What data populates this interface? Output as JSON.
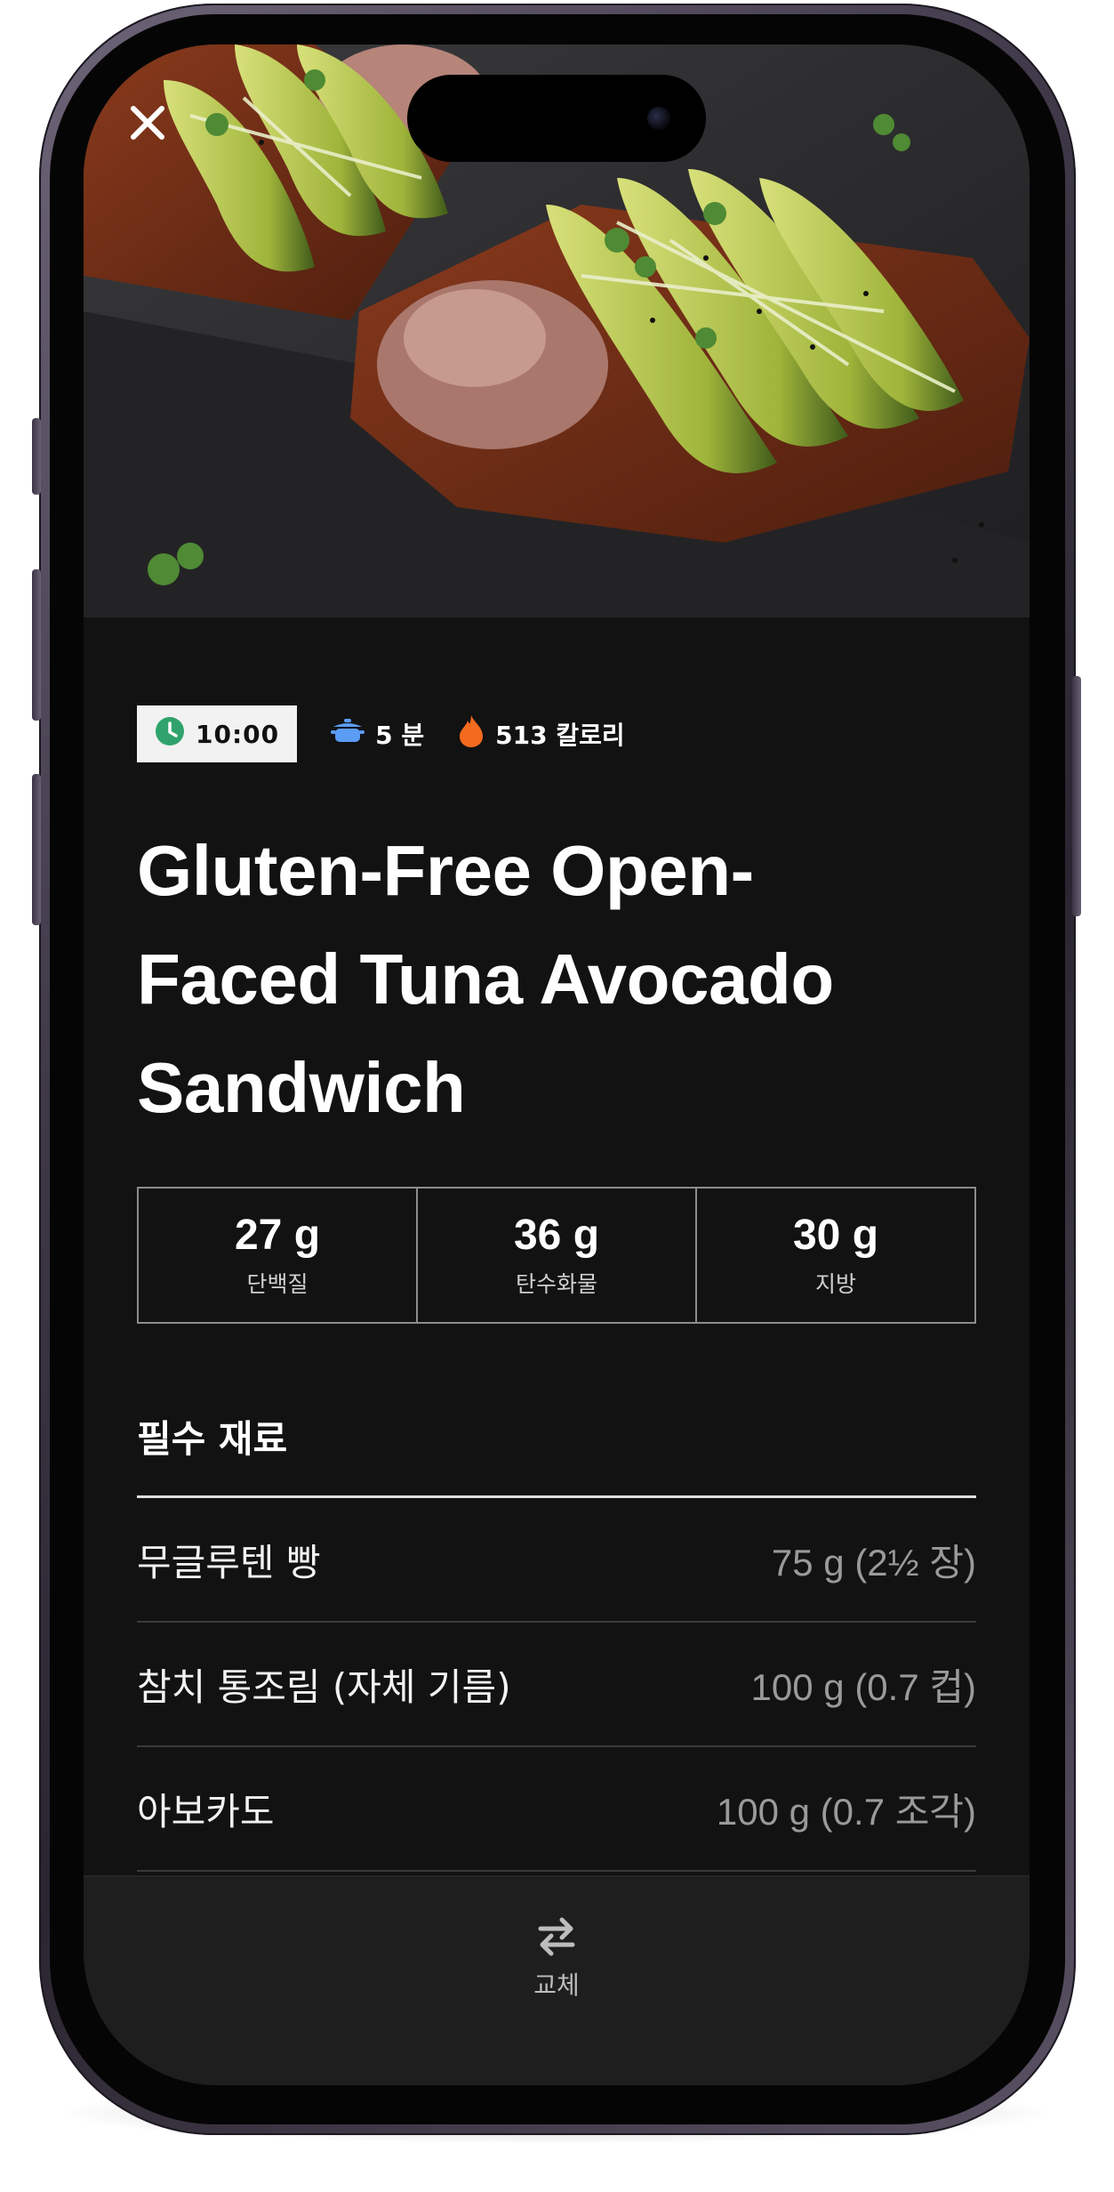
{
  "app": {
    "close_icon": "close-icon"
  },
  "meta": {
    "time": "10:00",
    "servings": "5 분",
    "calories": "513 칼로리",
    "colors": {
      "clock": "#2fa36b",
      "pot": "#5b9cf5",
      "flame": "#f46a1e"
    }
  },
  "recipe": {
    "title": "Gluten-Free Open-Faced Tuna Avocado Sandwich"
  },
  "macros": [
    {
      "value": "27 g",
      "label": "단백질"
    },
    {
      "value": "36 g",
      "label": "탄수화물"
    },
    {
      "value": "30 g",
      "label": "지방"
    }
  ],
  "ingredients": {
    "heading": "필수 재료",
    "items": [
      {
        "name": "무글루텐 빵",
        "amount": "75 g (2½ 장)"
      },
      {
        "name": "참치 통조림 (자체 기름)",
        "amount": "100 g (0.7 컵)"
      },
      {
        "name": "아보카도",
        "amount": "100 g (0.7 조각)"
      }
    ]
  },
  "bottom_bar": {
    "swap_label": "교체",
    "swap_icon": "swap-arrows-icon"
  }
}
